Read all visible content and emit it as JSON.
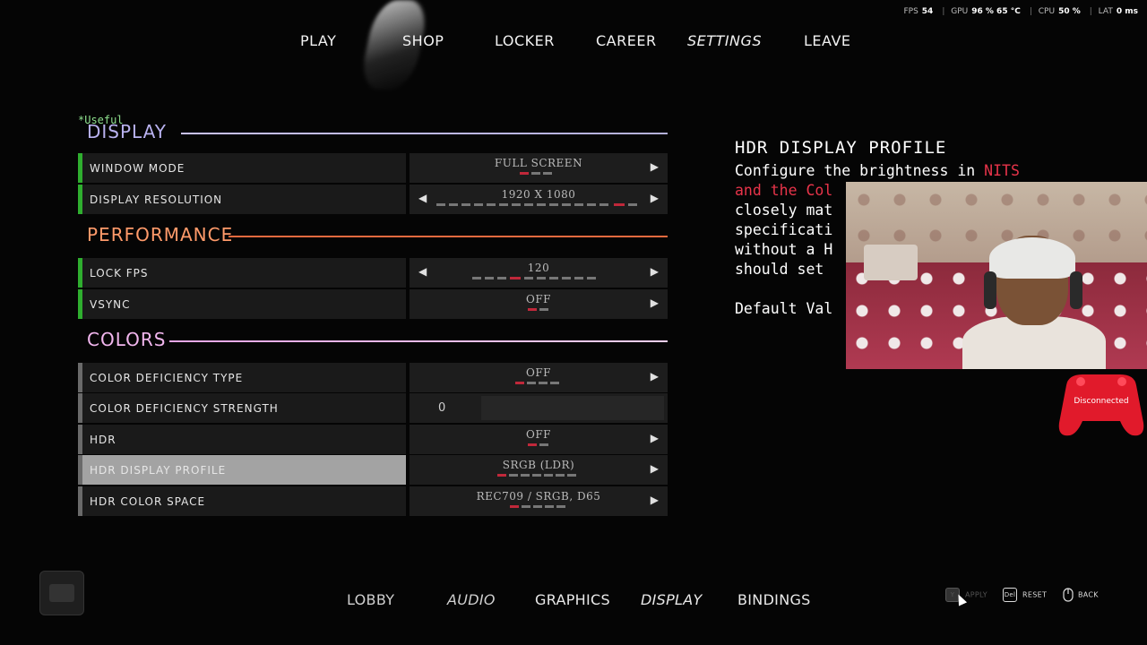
{
  "stats": {
    "fps_label": "FPS",
    "fps_value": "54",
    "gpu_label": "GPU",
    "gpu_value": "96 % 65 °C",
    "cpu_label": "CPU",
    "cpu_value": "50 %",
    "lat_label": "LAT",
    "lat_value": "0 ms"
  },
  "top_nav": {
    "play": "PLAY",
    "shop": "SHOP",
    "locker": "LOCKER",
    "career": "CAREER",
    "settings": "SETTINGS",
    "leave": "LEAVE",
    "active": "SETTINGS"
  },
  "panel": {
    "useful_tag": "*Useful",
    "sections": {
      "display": {
        "title": "DISPLAY",
        "color": "#b9b2f0"
      },
      "performance": {
        "title": "PERFORMANCE",
        "color": "#ff9a6a"
      },
      "colors": {
        "title": "COLORS",
        "color": "#f2b6ee"
      }
    },
    "rows": {
      "window_mode": {
        "label": "WINDOW MODE",
        "value": "FULL SCREEN"
      },
      "display_resolution": {
        "label": "DISPLAY RESOLUTION",
        "value": "1920 X 1080"
      },
      "lock_fps": {
        "label": "LOCK FPS",
        "value": "120"
      },
      "vsync": {
        "label": "VSYNC",
        "value": "OFF"
      },
      "color_deficiency_type": {
        "label": "COLOR DEFICIENCY TYPE",
        "value": "OFF"
      },
      "color_deficiency_strength": {
        "label": "COLOR DEFICIENCY STRENGTH",
        "value": "0"
      },
      "hdr": {
        "label": "HDR",
        "value": "OFF"
      },
      "hdr_display_profile": {
        "label": "HDR DISPLAY PROFILE",
        "value": "SRGB (LDR)"
      },
      "hdr_color_space": {
        "label": "HDR COLOR SPACE",
        "value": "REC709 / SRGB, D65"
      }
    },
    "colors": {
      "green_bar": "#2fae2f",
      "grey_bar": "#6a6a6a",
      "active_row": "#a3a3a3",
      "dot_active": "#c0283a"
    }
  },
  "description": {
    "title": "HDR DISPLAY PROFILE",
    "line1_a": "Configure the brightness in ",
    "line1_b": "NITS",
    "line2_a": "and the Col",
    "line3": "closely mat",
    "line4": "specificati",
    "line5": "without a H",
    "line6": "should set",
    "line7": "Default Val"
  },
  "controller": {
    "status": "Disconnected",
    "color": "#e11a2b"
  },
  "bottom_nav": {
    "lobby": "LOBBY",
    "audio": "AUDIO",
    "graphics": "GRAPHICS",
    "display": "DISPLAY",
    "bindings": "BINDINGS"
  },
  "hints": {
    "apply_key": "Y",
    "apply": "APPLY",
    "reset_key": "Del",
    "reset": "RESET",
    "back": "BACK"
  }
}
